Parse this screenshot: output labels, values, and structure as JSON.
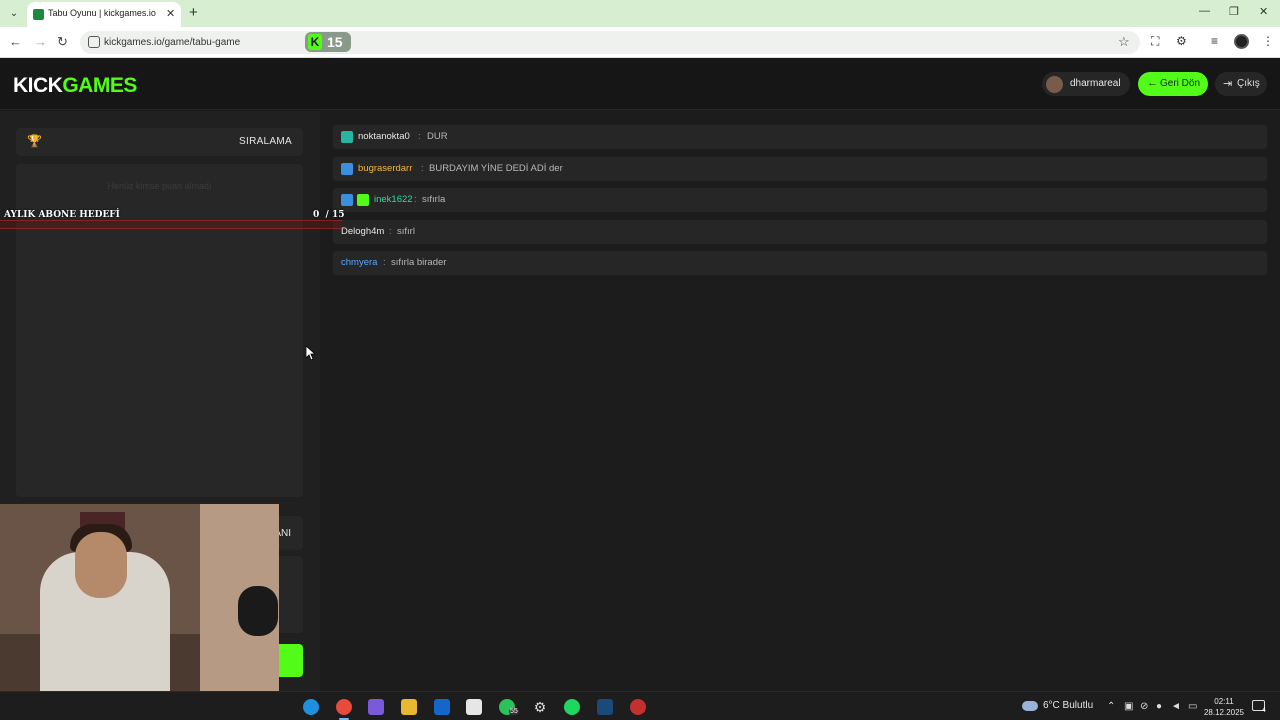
{
  "browser": {
    "tab_title": "Tabu Oyunu | kickgames.io",
    "url": "kickgames.io/game/tabu-game",
    "extension_badge": "15"
  },
  "header": {
    "logo_part1": "KICK",
    "logo_part2": "GAMES",
    "username": "dharmareal",
    "back_label": "Geri Dön",
    "exit_label": "Çıkış"
  },
  "leaderboard": {
    "title": "SIRALAMA",
    "empty_text": "Henüz kimse puan almadı"
  },
  "sub_goal": {
    "label": "AYLIK ABONE HEDEFİ",
    "current": "0",
    "target": "/ 15"
  },
  "bottom_card": {
    "title_fragment": "ANI"
  },
  "chat": [
    {
      "user": "noktanokta0",
      "text": "DUR",
      "color": "#e6e6e6",
      "badges": [
        "mod"
      ]
    },
    {
      "user": "bugraserdarr",
      "text": "BURDAYIM YİNE DEDİ ADİ der",
      "color": "#f0b63a",
      "badges": [
        "vip"
      ]
    },
    {
      "user": "inek1622",
      "text": "sıfırla",
      "color": "#3ad4a8",
      "badges": [
        "vip",
        "gift"
      ]
    },
    {
      "user": "Delogh4m",
      "text": "sıfırl",
      "color": "#e6e6e6",
      "badges": []
    },
    {
      "user": "chmyera",
      "text": "sıfırla birader",
      "color": "#5aa8ff",
      "badges": []
    }
  ],
  "taskbar": {
    "whatsapp_count": "55",
    "weather": "6°C Bulutlu",
    "time": "02:11",
    "date": "28.12.2025",
    "notification_count": "4"
  }
}
